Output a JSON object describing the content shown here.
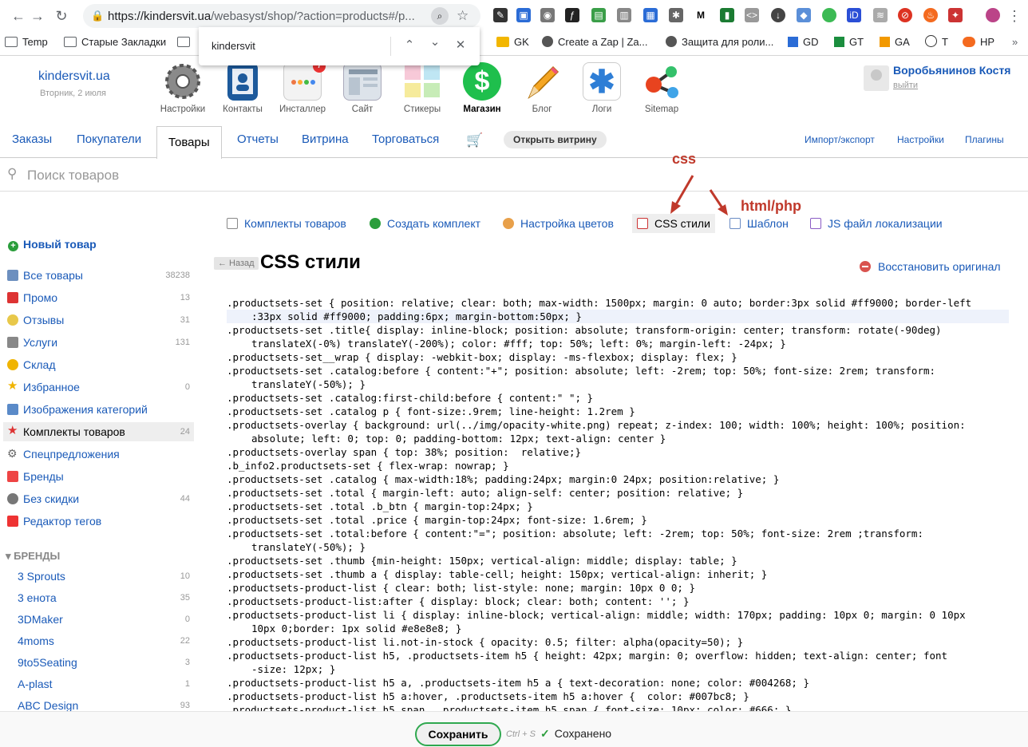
{
  "browser": {
    "url_host": "https://kindersvit.ua",
    "url_path": "/webasyst/shop/?action=products#/p...",
    "find_query": "kindersvit",
    "bookmarks": [
      "Temp",
      "Старые Закладки",
      "GK",
      "Create a Zap | Za...",
      "Защита для роли...",
      "GD",
      "GT",
      "GA",
      "T",
      "HP"
    ]
  },
  "header": {
    "brand": "kindersvit.ua",
    "date": "Вторник, 2 июля",
    "apps": [
      {
        "label": "Настройки",
        "icon": "settings-gear-icon"
      },
      {
        "label": "Контакты",
        "icon": "contacts-icon"
      },
      {
        "label": "Инсталлер",
        "icon": "installer-icon",
        "badge": "7"
      },
      {
        "label": "Сайт",
        "icon": "site-icon"
      },
      {
        "label": "Стикеры",
        "icon": "stickers-icon"
      },
      {
        "label": "Магазин",
        "icon": "shop-dollar-icon"
      },
      {
        "label": "Блог",
        "icon": "blog-pencil-icon"
      },
      {
        "label": "Логи",
        "icon": "logs-icon"
      },
      {
        "label": "Sitemap",
        "icon": "sitemap-icon"
      }
    ],
    "user_name": "Воробьянинов Костя",
    "logout": "выйти"
  },
  "tabs": {
    "items": [
      "Заказы",
      "Покупатели",
      "Товары",
      "Отчеты",
      "Витрина",
      "Торговаться"
    ],
    "open_store": "Открыть витрину",
    "right": [
      "Импорт/экспорт",
      "Настройки",
      "Плагины"
    ]
  },
  "search": {
    "placeholder": "Поиск товаров"
  },
  "annotations": {
    "css": "css",
    "html": "html/php"
  },
  "subnav": [
    "Комплекты товаров",
    "Создать комплект",
    "Настройка цветов",
    "CSS стили",
    "Шаблон",
    "JS файл локализации"
  ],
  "page": {
    "back": "← Назад",
    "title": "CSS стили",
    "restore": "Восстановить оригинал"
  },
  "sidebar": {
    "new_product": "Новый товар",
    "items": [
      {
        "label": "Все товары",
        "count": "38238"
      },
      {
        "label": "Промо",
        "count": "13"
      },
      {
        "label": "Отзывы",
        "count": "31"
      },
      {
        "label": "Услуги",
        "count": "131"
      },
      {
        "label": "Склад",
        "count": ""
      },
      {
        "label": "Избранное",
        "count": "0"
      },
      {
        "label": "Изображения категорий",
        "count": ""
      },
      {
        "label": "Комплекты товаров",
        "count": "24"
      },
      {
        "label": "Спецпредложения",
        "count": ""
      },
      {
        "label": "Бренды",
        "count": ""
      },
      {
        "label": "Без скидки",
        "count": "44"
      },
      {
        "label": "Редактор тегов",
        "count": ""
      }
    ],
    "brands_header": "БРЕНДЫ",
    "brands": [
      {
        "label": "3 Sprouts",
        "count": "10"
      },
      {
        "label": "3 енота",
        "count": "35"
      },
      {
        "label": "3DMaker",
        "count": "0"
      },
      {
        "label": "4moms",
        "count": "22"
      },
      {
        "label": "9to5Seating",
        "count": "3"
      },
      {
        "label": "A-plast",
        "count": "1"
      },
      {
        "label": "ABC Design",
        "count": "93"
      }
    ]
  },
  "code_lines": [
    ".productsets-set { position: relative; clear: both; max-width: 1500px; margin: 0 auto; border:3px solid #ff9000; border-left",
    ":33px solid #ff9000; padding:6px; margin-bottom:50px; }",
    ".productsets-set .title{ display: inline-block; position: absolute; transform-origin: center; transform: rotate(-90deg)",
    "translateX(-0%) translateY(-200%); color: #fff; top: 50%; left: 0%; margin-left: -24px; }",
    ".productsets-set__wrap { display: -webkit-box; display: -ms-flexbox; display: flex; }",
    ".productsets-set .catalog:before { content:\"+\"; position: absolute; left: -2rem; top: 50%; font-size: 2rem; transform:",
    "translateY(-50%); }",
    ".productsets-set .catalog:first-child:before { content:\" \"; }",
    ".productsets-set .catalog p { font-size:.9rem; line-height: 1.2rem }",
    ".productsets-overlay { background: url(../img/opacity-white.png) repeat; z-index: 100; width: 100%; height: 100%; position:",
    "absolute; left: 0; top: 0; padding-bottom: 12px; text-align: center }",
    ".productsets-overlay span { top: 38%; position:  relative;}",
    ".b_info2.productsets-set { flex-wrap: nowrap; }",
    ".productsets-set .catalog { max-width:18%; padding:24px; margin:0 24px; position:relative; }",
    ".productsets-set .total { margin-left: auto; align-self: center; position: relative; }",
    ".productsets-set .total .b_btn { margin-top:24px; }",
    ".productsets-set .total .price { margin-top:24px; font-size: 1.6rem; }",
    ".productsets-set .total:before { content:\"=\"; position: absolute; left: -2rem; top: 50%; font-size: 2rem ;transform:",
    "translateY(-50%); }",
    ".productsets-set .thumb {min-height: 150px; vertical-align: middle; display: table; }",
    ".productsets-set .thumb a { display: table-cell; height: 150px; vertical-align: inherit; }",
    ".productsets-product-list { clear: both; list-style: none; margin: 10px 0 0; }",
    ".productsets-product-list:after { display: block; clear: both; content: ''; }",
    ".productsets-product-list li { display: inline-block; vertical-align: middle; width: 170px; padding: 10px 0; margin: 0 10px",
    "10px 0;border: 1px solid #e8e8e8; }",
    ".productsets-product-list li.not-in-stock { opacity: 0.5; filter: alpha(opacity=50); }",
    ".productsets-product-list h5, .productsets-item h5 { height: 42px; margin: 0; overflow: hidden; text-align: center; font",
    "-size: 12px; }",
    ".productsets-product-list h5 a, .productsets-item h5 a { text-decoration: none; color: #004268; }",
    ".productsets-product-list h5 a:hover, .productsets-item h5 a:hover {  color: #007bc8; }",
    ".productsets-product-list h5 span, .productsets-item h5 span { font-size: 10px; color: #666; }"
  ],
  "savebar": {
    "save": "Сохранить",
    "hotkey": "Ctrl + S",
    "status": "Сохранено"
  }
}
